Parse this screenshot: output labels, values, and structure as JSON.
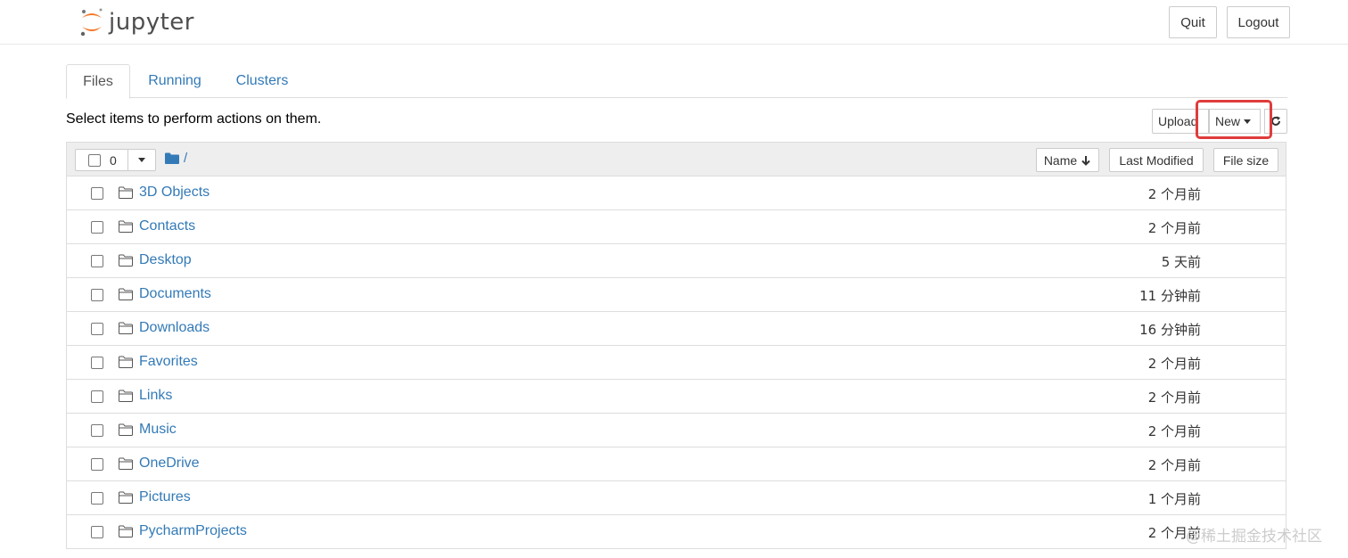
{
  "header": {
    "app_name": "jupyter",
    "quit_label": "Quit",
    "logout_label": "Logout"
  },
  "tabs": [
    {
      "label": "Files",
      "active": true
    },
    {
      "label": "Running",
      "active": false
    },
    {
      "label": "Clusters",
      "active": false
    }
  ],
  "toolbar": {
    "hint": "Select items to perform actions on them.",
    "upload_label": "Upload",
    "new_label": "New",
    "refresh_icon": "refresh-icon"
  },
  "list_header": {
    "selected_count": "0",
    "breadcrumb": "/",
    "sort_name_label": "Name",
    "sort_modified_label": "Last Modified",
    "sort_size_label": "File size"
  },
  "files": [
    {
      "name": "3D Objects",
      "modified": "2 个月前"
    },
    {
      "name": "Contacts",
      "modified": "2 个月前"
    },
    {
      "name": "Desktop",
      "modified": "5 天前"
    },
    {
      "name": "Documents",
      "modified": "11 分钟前"
    },
    {
      "name": "Downloads",
      "modified": "16 分钟前"
    },
    {
      "name": "Favorites",
      "modified": "2 个月前"
    },
    {
      "name": "Links",
      "modified": "2 个月前"
    },
    {
      "name": "Music",
      "modified": "2 个月前"
    },
    {
      "name": "OneDrive",
      "modified": "2 个月前"
    },
    {
      "name": "Pictures",
      "modified": "1 个月前"
    },
    {
      "name": "PycharmProjects",
      "modified": "2 个月前"
    }
  ],
  "watermark": "@稀土掘金技术社区",
  "colors": {
    "link": "#337ab7",
    "highlight": "#e03c3c",
    "jupyter_orange": "#f37726"
  }
}
